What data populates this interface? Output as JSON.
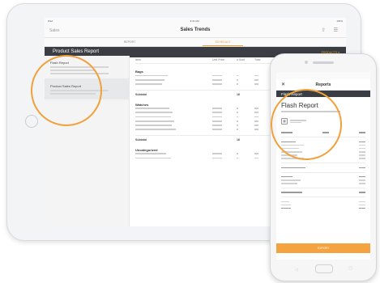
{
  "tablet": {
    "status": {
      "left": "iPad",
      "center": "9:41 AM",
      "right": "100%"
    },
    "nav": {
      "left": "Sales",
      "title": "Sales Trends",
      "icons": "⇧ ☰"
    },
    "segments": [
      {
        "label": "REPORT"
      },
      {
        "label": "SCHEDULE",
        "active": true
      }
    ],
    "header": {
      "title": "Product Sales Report",
      "right": "PRODUCTS ▾"
    },
    "sidebar": [
      {
        "title": "Flash Report"
      },
      {
        "title": "Product Sales Report"
      }
    ],
    "table": {
      "headers": [
        "Item",
        "Unit Price",
        "# Sold",
        "Total"
      ],
      "groups": [
        {
          "name": "Bags",
          "rows": 3,
          "subtotal_label": "Subtotal",
          "subtotal_value": "16"
        },
        {
          "name": "Watches",
          "rows": 6,
          "subtotal_label": "Subtotal",
          "subtotal_value": "16"
        },
        {
          "name": "Uncategorized",
          "rows": 2
        }
      ]
    }
  },
  "phone": {
    "nav": {
      "close": "✕",
      "title": "Reports"
    },
    "header": {
      "title": "Flash Report"
    },
    "report_title": "Flash Report",
    "footer_button": "EXPORT"
  },
  "colors": {
    "accent": "#f0a030",
    "dark_header": "#3a3e44"
  }
}
